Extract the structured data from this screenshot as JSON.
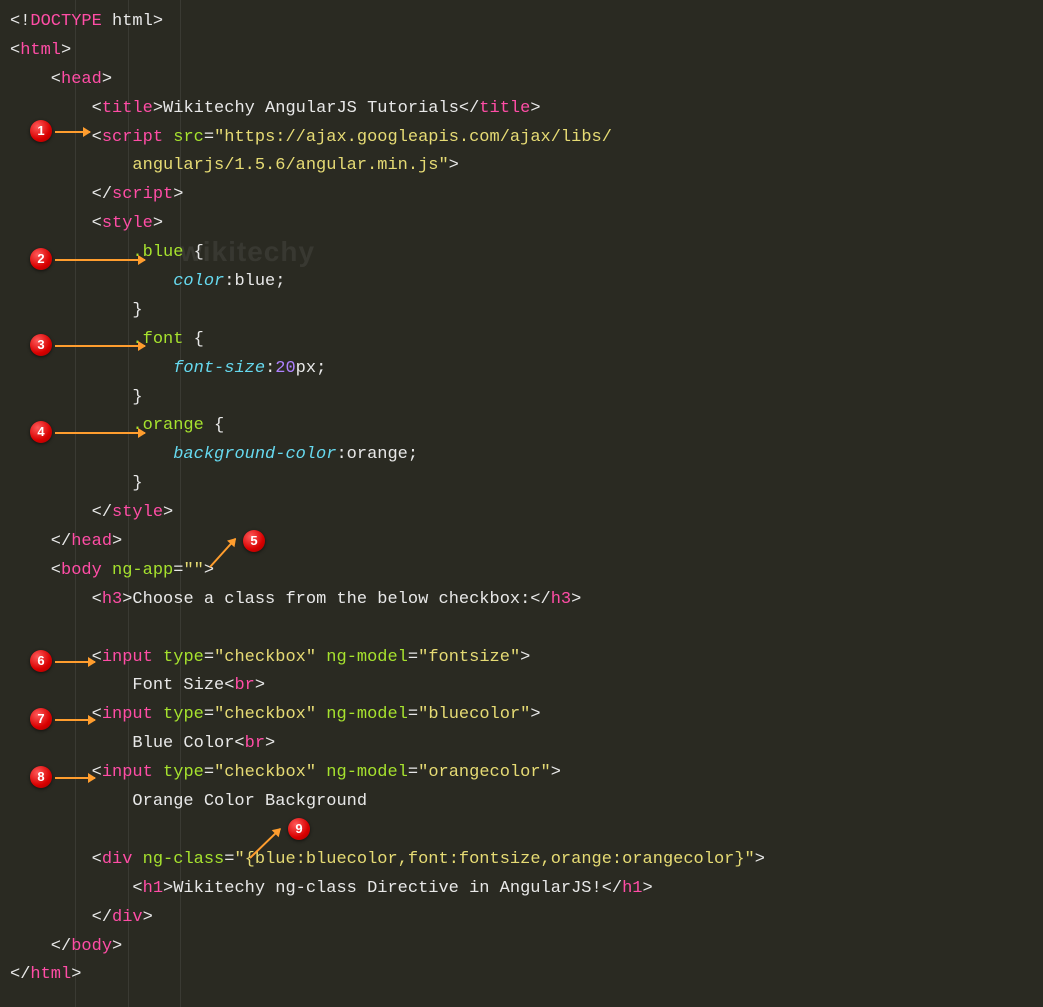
{
  "watermark": "wikitechy",
  "badges": [
    "1",
    "2",
    "3",
    "4",
    "5",
    "6",
    "7",
    "8",
    "9"
  ],
  "code": {
    "l01": {
      "a": "<!",
      "b": "DOCTYPE",
      "c": " html>"
    },
    "l02": {
      "a": "<",
      "b": "html",
      "c": ">"
    },
    "l03": {
      "a": "    <",
      "b": "head",
      "c": ">"
    },
    "l04": {
      "a": "        <",
      "b": "title",
      "c": ">Wikitechy AngularJS Tutorials</",
      "d": "title",
      "e": ">"
    },
    "l05": {
      "a": "        <",
      "b": "script",
      "c": " ",
      "d": "src",
      "e": "=",
      "f": "\"https://ajax.googleapis.com/ajax/libs/"
    },
    "l06": {
      "a": "            angularjs/1.5.6/angular.min.js\"",
      "b": ">"
    },
    "l07": {
      "a": "        </",
      "b": "script",
      "c": ">"
    },
    "l08": {
      "a": "        <",
      "b": "style",
      "c": ">"
    },
    "l09": {
      "a": "            ",
      "b": ".blue",
      "c": " {"
    },
    "l10": {
      "a": "                ",
      "b": "color",
      "c": ":blue;"
    },
    "l11": {
      "a": "            }"
    },
    "l12": {
      "a": "            ",
      "b": ".font",
      "c": " {"
    },
    "l13": {
      "a": "                ",
      "b": "font-size",
      "c": ":",
      "d": "20",
      "e": "px;"
    },
    "l14": {
      "a": "            }"
    },
    "l15": {
      "a": "            ",
      "b": ".orange",
      "c": " {"
    },
    "l16": {
      "a": "                ",
      "b": "background-color",
      "c": ":orange;"
    },
    "l17": {
      "a": "            }"
    },
    "l18": {
      "a": "        </",
      "b": "style",
      "c": ">"
    },
    "l19": {
      "a": "    </",
      "b": "head",
      "c": ">"
    },
    "l20": {
      "a": "    <",
      "b": "body",
      "c": " ",
      "d": "ng-app",
      "e": "=",
      "f": "\"\"",
      "g": ">"
    },
    "l21": {
      "a": "        <",
      "b": "h3",
      "c": ">Choose a class from the below checkbox:</",
      "d": "h3",
      "e": ">"
    },
    "l22": {
      "a": ""
    },
    "l23": {
      "a": "        <",
      "b": "input",
      "c": " ",
      "d": "type",
      "e": "=",
      "f": "\"checkbox\"",
      "g": " ",
      "h": "ng-model",
      "i": "=",
      "j": "\"fontsize\"",
      "k": ">"
    },
    "l24": {
      "a": "            Font Size<",
      "b": "br",
      "c": ">"
    },
    "l25": {
      "a": "        <",
      "b": "input",
      "c": " ",
      "d": "type",
      "e": "=",
      "f": "\"checkbox\"",
      "g": " ",
      "h": "ng-model",
      "i": "=",
      "j": "\"bluecolor\"",
      "k": ">"
    },
    "l26": {
      "a": "            Blue Color<",
      "b": "br",
      "c": ">"
    },
    "l27": {
      "a": "        <",
      "b": "input",
      "c": " ",
      "d": "type",
      "e": "=",
      "f": "\"checkbox\"",
      "g": " ",
      "h": "ng-model",
      "i": "=",
      "j": "\"orangecolor\"",
      "k": ">"
    },
    "l28": {
      "a": "            Orange Color Background"
    },
    "l29": {
      "a": ""
    },
    "l30": {
      "a": "        <",
      "b": "div",
      "c": " ",
      "d": "ng-class",
      "e": "=",
      "f": "\"{blue:bluecolor,font:fontsize,orange:orangecolor}\"",
      "g": ">"
    },
    "l31": {
      "a": "            <",
      "b": "h1",
      "c": ">Wikitechy ng-class Directive in AngularJS!</",
      "d": "h1",
      "e": ">"
    },
    "l32": {
      "a": "        </",
      "b": "div",
      "c": ">"
    },
    "l33": {
      "a": "    </",
      "b": "body",
      "c": ">"
    },
    "l34": {
      "a": "</",
      "b": "html",
      "c": ">"
    }
  }
}
